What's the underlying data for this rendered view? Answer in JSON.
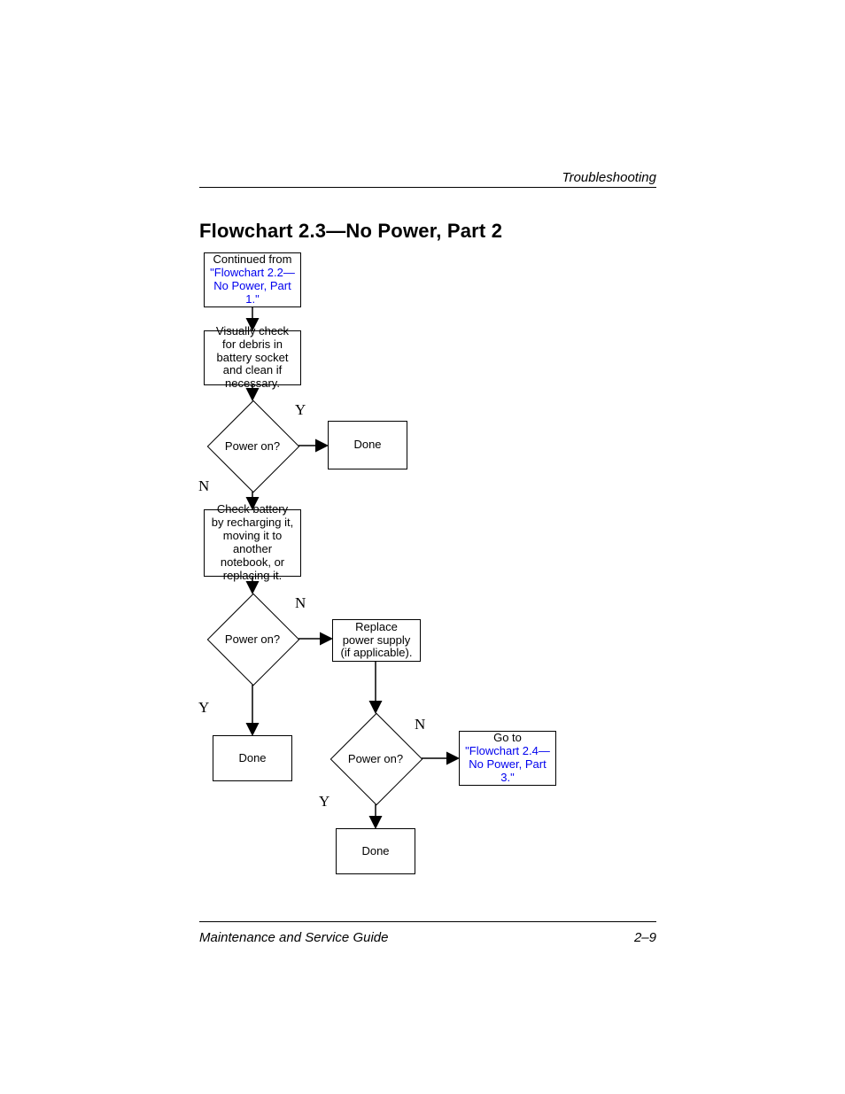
{
  "header": {
    "section": "Troubleshooting"
  },
  "footer": {
    "left": "Maintenance and Service Guide",
    "right": "2–9"
  },
  "title": "Flowchart 2.3—No Power, Part 2",
  "chart_data": {
    "type": "flowchart",
    "nodes": [
      {
        "id": "A",
        "shape": "process",
        "label_plain": "Continued from",
        "label_link": "\"Flowchart 2.2—No Power, Part 1.\""
      },
      {
        "id": "B",
        "shape": "process",
        "label": "Visually check for debris in battery socket and clean if necessary."
      },
      {
        "id": "C",
        "shape": "decision",
        "label": "Power on?"
      },
      {
        "id": "D",
        "shape": "process",
        "label": "Done"
      },
      {
        "id": "E",
        "shape": "process",
        "label": "Check battery by recharging it, moving it to another notebook, or replacing it."
      },
      {
        "id": "F",
        "shape": "decision",
        "label": "Power on?"
      },
      {
        "id": "G",
        "shape": "process",
        "label": "Replace power supply (if applicable)."
      },
      {
        "id": "H",
        "shape": "process",
        "label": "Done"
      },
      {
        "id": "I",
        "shape": "decision",
        "label": "Power on?"
      },
      {
        "id": "J",
        "shape": "process",
        "label_plain": "Go to",
        "label_link": "\"Flowchart 2.4—No Power, Part 3.\""
      },
      {
        "id": "K",
        "shape": "process",
        "label": "Done"
      }
    ],
    "edges": [
      {
        "from": "A",
        "to": "B",
        "label": ""
      },
      {
        "from": "B",
        "to": "C",
        "label": ""
      },
      {
        "from": "C",
        "to": "D",
        "label": "Y"
      },
      {
        "from": "C",
        "to": "E",
        "label": "N"
      },
      {
        "from": "E",
        "to": "F",
        "label": ""
      },
      {
        "from": "F",
        "to": "G",
        "label": "N"
      },
      {
        "from": "F",
        "to": "H",
        "label": "Y"
      },
      {
        "from": "G",
        "to": "I",
        "label": ""
      },
      {
        "from": "I",
        "to": "J",
        "label": "N"
      },
      {
        "from": "I",
        "to": "K",
        "label": "Y"
      }
    ]
  },
  "labels": {
    "Y": "Y",
    "N": "N"
  }
}
